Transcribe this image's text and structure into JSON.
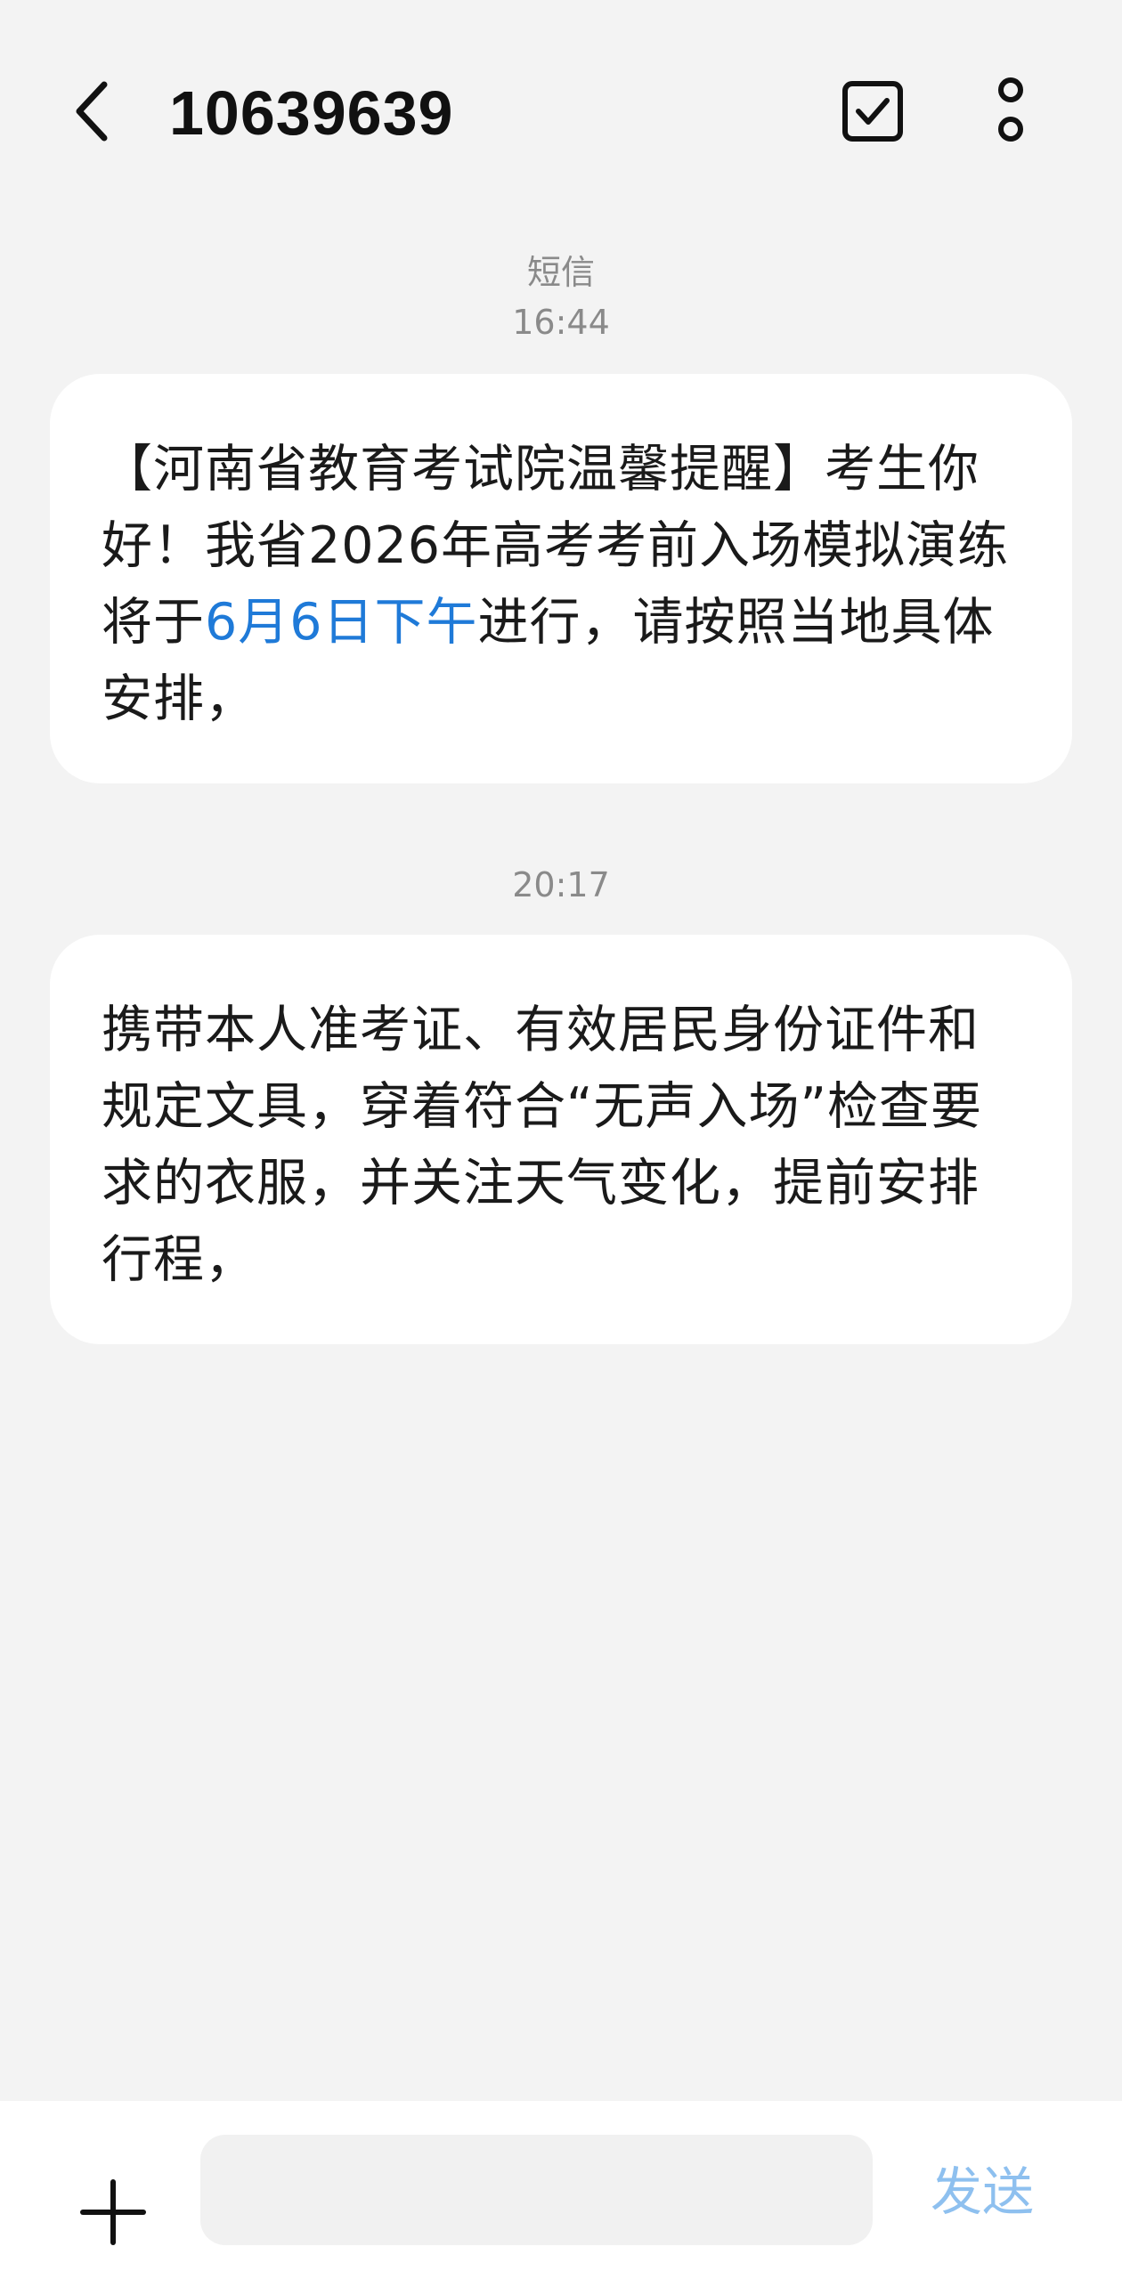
{
  "header": {
    "title": "10639639",
    "back_icon": "chevron-left-icon",
    "select_icon": "checkbox-checked-icon",
    "more_icon": "more-vertical-icon"
  },
  "conversation": {
    "channel_label": "短信",
    "messages": [
      {
        "time": "16:44",
        "text_before": "【河南省教育考试院温馨提醒】考生你好！我省2026年高考考前入场模拟演练将于",
        "highlight": "6月6日下午",
        "text_after": "进行，请按照当地具体安排，"
      },
      {
        "time": "20:17",
        "text": "携带本人准考证、有效居民身份证件和规定文具，穿着符合“无声入场”检查要求的衣服，并关注天气变化，提前安排行程，"
      }
    ]
  },
  "composer": {
    "add_icon": "plus-icon",
    "input_value": "",
    "send_label": "发送"
  },
  "colors": {
    "background": "#f3f3f3",
    "bubble": "#ffffff",
    "link": "#1f7ad8",
    "send_disabled": "#8ec0ef",
    "timestamp": "#8a8a8a"
  }
}
